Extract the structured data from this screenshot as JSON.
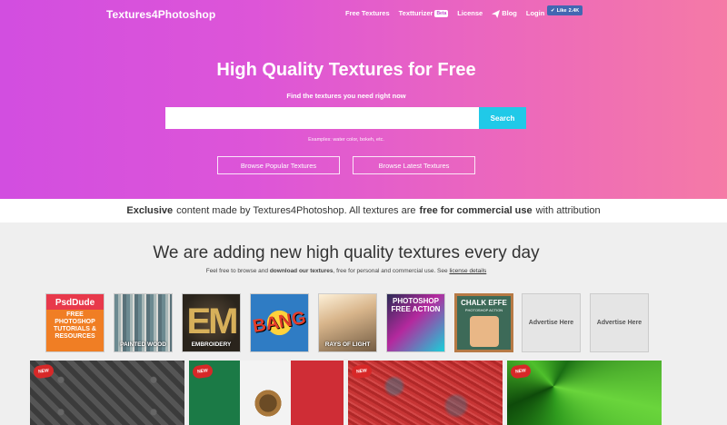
{
  "header": {
    "logo": "Textures4Photoshop",
    "nav": {
      "free_textures": "Free Textures",
      "texturizer": "Textturizer",
      "texturizer_badge": "Beta",
      "license": "License",
      "blog": "Blog",
      "login": "Login"
    },
    "like_button": {
      "label": "Like",
      "count": "2.4K"
    }
  },
  "hero": {
    "title": "High Quality Textures for Free",
    "subtitle": "Find the textures you need right now",
    "search": {
      "placeholder": "",
      "value": "",
      "button": "Search"
    },
    "examples": "Examples: water color, bokeh, etc.",
    "btn_popular": "Browse Popular Textures",
    "btn_latest": "Browse Latest Textures",
    "gradient_start": "#d24ee0",
    "gradient_end": "#f57aa6",
    "accent": "#20c9e8"
  },
  "banner": {
    "part1": "Exclusive",
    "part2": "content made by Textures4Photoshop. All textures are",
    "part3": "free for commercial use",
    "part4": "with attribution"
  },
  "section": {
    "title": "We are adding new high quality textures every day",
    "sub_part1": "Feel free to browse and",
    "sub_bold": "download our textures",
    "sub_part2": ", free for personal and commercial use. See",
    "sub_link": "license details"
  },
  "ads": {
    "psd_top": "PsdDude",
    "psd_lines": [
      "FREE",
      "PHOTOSHOP",
      "TUTORIALS &",
      "RESOURCES"
    ],
    "wood": "PAINTED WOOD",
    "embroidery": "EMBROIDERY",
    "embroidery_letters": "EM",
    "bang": "BANG",
    "rays": "RAYS OF LIGHT",
    "action_line1": "PHOTOSHOP",
    "action_line2": "FREE ACTION",
    "chalk_title": "CHALK EFFE",
    "chalk_sub": "PHOTOSHOP ACTION",
    "advertise_1": "Advertise Here",
    "advertise_2": "Advertise Here"
  },
  "tiles": {
    "new_label": "NEW"
  }
}
